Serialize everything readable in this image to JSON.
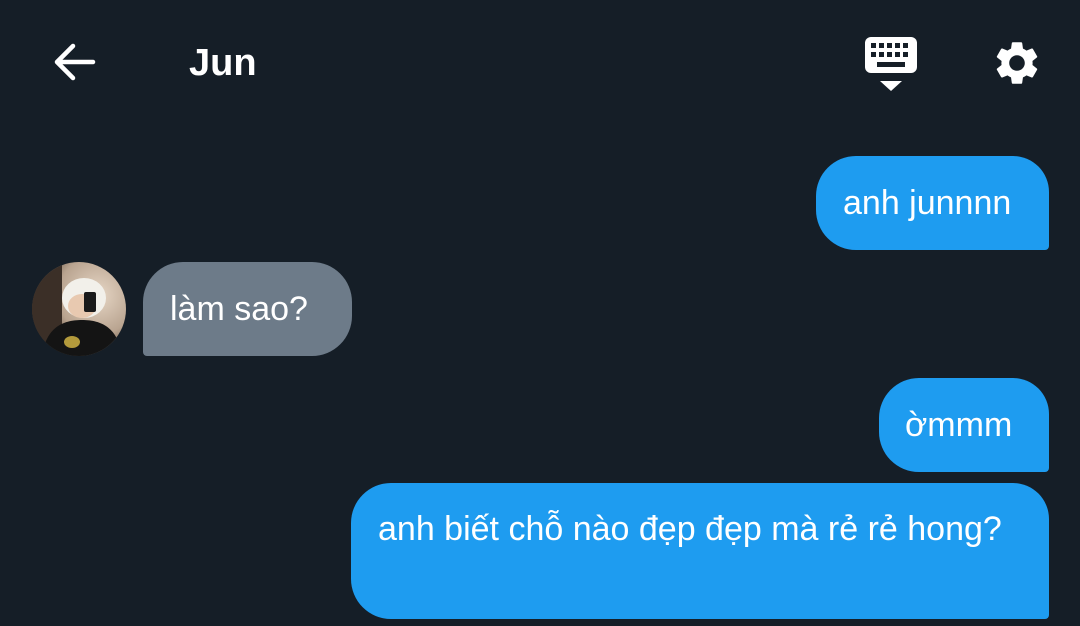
{
  "header": {
    "title": "Jun",
    "back_icon": "arrow-left-icon",
    "keyboard_icon": "keyboard-hide-icon",
    "settings_icon": "gear-icon"
  },
  "messages": [
    {
      "direction": "outgoing",
      "text": "anh junnnn"
    },
    {
      "direction": "incoming",
      "text": "làm sao?"
    },
    {
      "direction": "outgoing",
      "text": "ờmmm"
    },
    {
      "direction": "outgoing",
      "text": "anh biết chỗ nào đẹp đẹp mà rẻ rẻ hong?"
    }
  ],
  "colors": {
    "background": "#151e27",
    "outgoing_bubble": "#1e9cf0",
    "incoming_bubble": "#6d7b89",
    "text": "#ffffff"
  }
}
